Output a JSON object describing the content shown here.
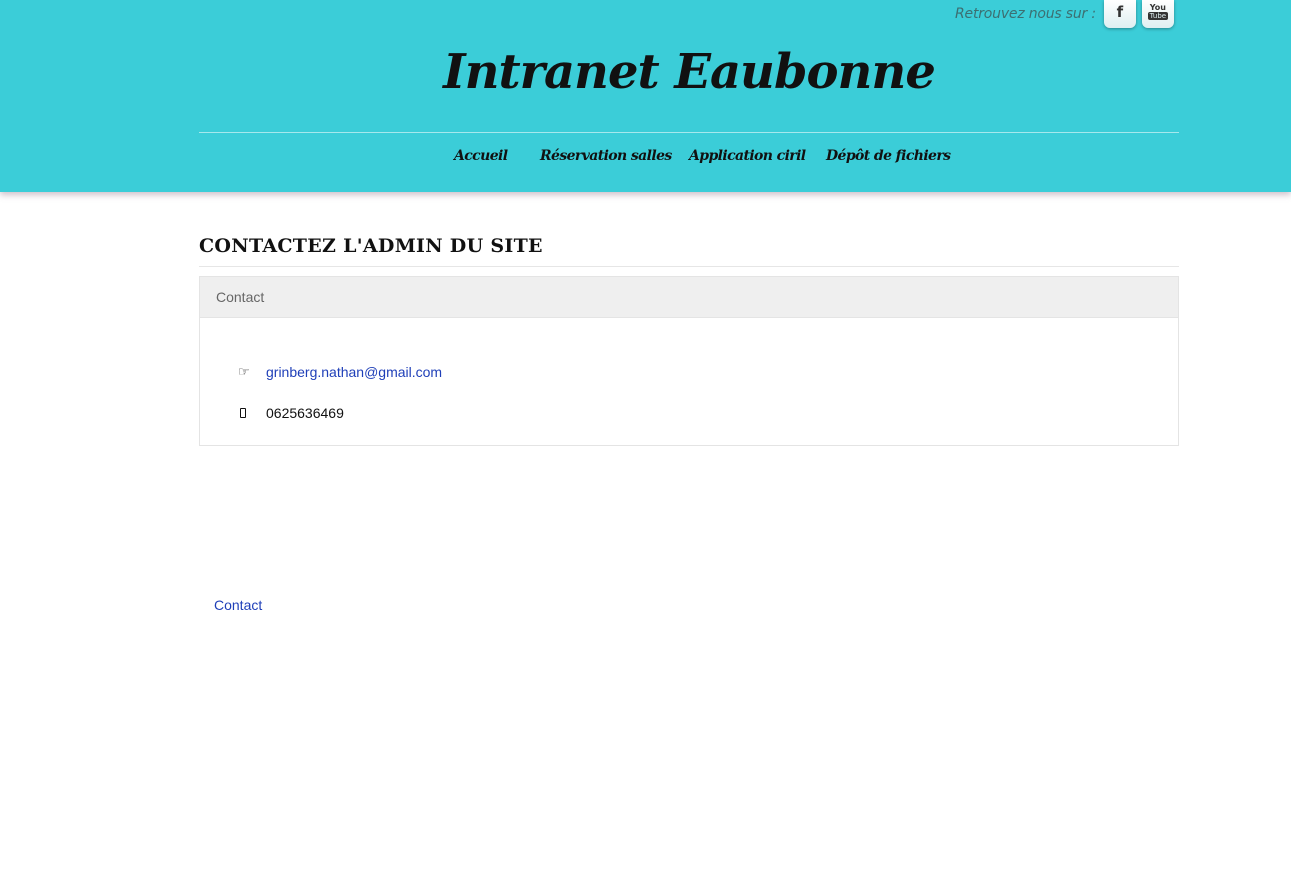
{
  "header": {
    "social_label": "Retrouvez nous sur :",
    "social": [
      {
        "name": "facebook",
        "glyph": "f",
        "icon": "facebook-icon"
      },
      {
        "name": "youtube",
        "glyph_top": "You",
        "glyph_bottom": "Tube",
        "icon": "youtube-icon"
      }
    ],
    "site_title": "Intranet Eaubonne",
    "nav": [
      "Accueil",
      "Réservation salles",
      "Application ciril",
      "Dépôt de fichiers"
    ],
    "background": "#3bcdd8"
  },
  "main": {
    "page_heading": "CONTACTEZ L'ADMIN DU SITE",
    "panel": {
      "title": "Contact",
      "email_icon": "hand-pointer-icon",
      "email": "grinberg.nathan@gmail.com",
      "phone_icon": "mobile-phone-icon",
      "phone": "0625636469"
    }
  },
  "footer": {
    "link": "Contact"
  },
  "colors": {
    "link": "#1f3fb8",
    "panel_header": "#efefef"
  }
}
